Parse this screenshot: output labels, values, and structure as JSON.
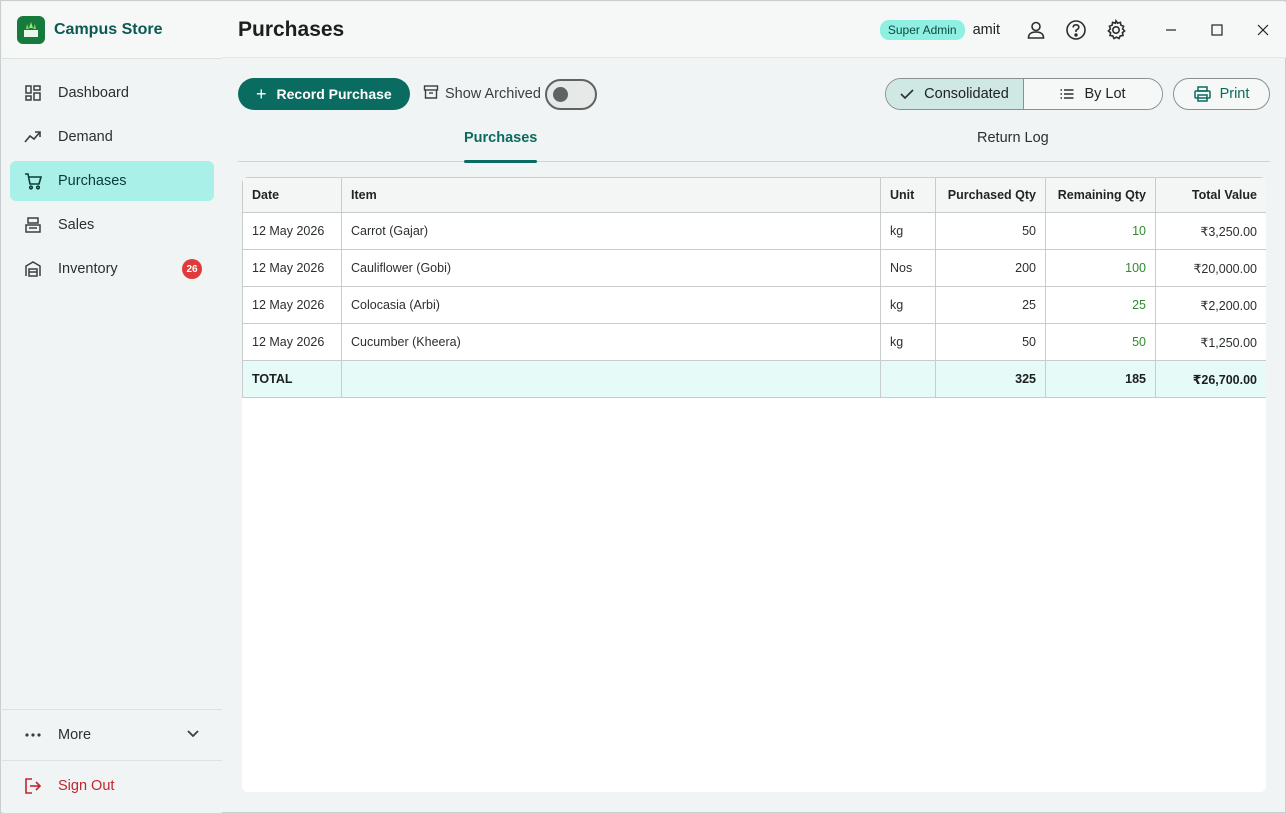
{
  "app": {
    "name": "Campus Store"
  },
  "sidebar": {
    "items": [
      {
        "label": "Dashboard",
        "icon": "dashboard-icon"
      },
      {
        "label": "Demand",
        "icon": "trending-icon"
      },
      {
        "label": "Purchases",
        "icon": "cart-icon",
        "active": true
      },
      {
        "label": "Sales",
        "icon": "cash-register-icon"
      },
      {
        "label": "Inventory",
        "icon": "warehouse-icon",
        "badge": "26"
      }
    ],
    "more_label": "More",
    "signout_label": "Sign Out"
  },
  "header": {
    "title": "Purchases",
    "role": "Super Admin",
    "user": "amit"
  },
  "toolbar": {
    "record_label": "Record Purchase",
    "archived_label": "Show Archived",
    "archived_on": false,
    "view_consolidated": "Consolidated",
    "view_bylot": "By Lot",
    "print_label": "Print"
  },
  "tabs": {
    "purchases": "Purchases",
    "return_log": "Return Log"
  },
  "table": {
    "headers": [
      "Date",
      "Item",
      "Unit",
      "Purchased Qty",
      "Remaining Qty",
      "Total Value"
    ],
    "rows": [
      {
        "date": "12 May 2026",
        "item": "Carrot (Gajar)",
        "unit": "kg",
        "purchased": "50",
        "remaining": "10",
        "total": "₹3,250.00"
      },
      {
        "date": "12 May 2026",
        "item": "Cauliflower (Gobi)",
        "unit": "Nos",
        "purchased": "200",
        "remaining": "100",
        "total": "₹20,000.00"
      },
      {
        "date": "12 May 2026",
        "item": "Colocasia (Arbi)",
        "unit": "kg",
        "purchased": "25",
        "remaining": "25",
        "total": "₹2,200.00"
      },
      {
        "date": "12 May 2026",
        "item": "Cucumber (Kheera)",
        "unit": "kg",
        "purchased": "50",
        "remaining": "50",
        "total": "₹1,250.00"
      }
    ],
    "total": {
      "label": "TOTAL",
      "purchased": "325",
      "remaining": "185",
      "total": "₹26,700.00"
    }
  },
  "colors": {
    "accent": "#0a6b60",
    "active_nav": "#a9f0e8",
    "badge": "#e03a3a",
    "remaining": "#2e8b2e"
  }
}
